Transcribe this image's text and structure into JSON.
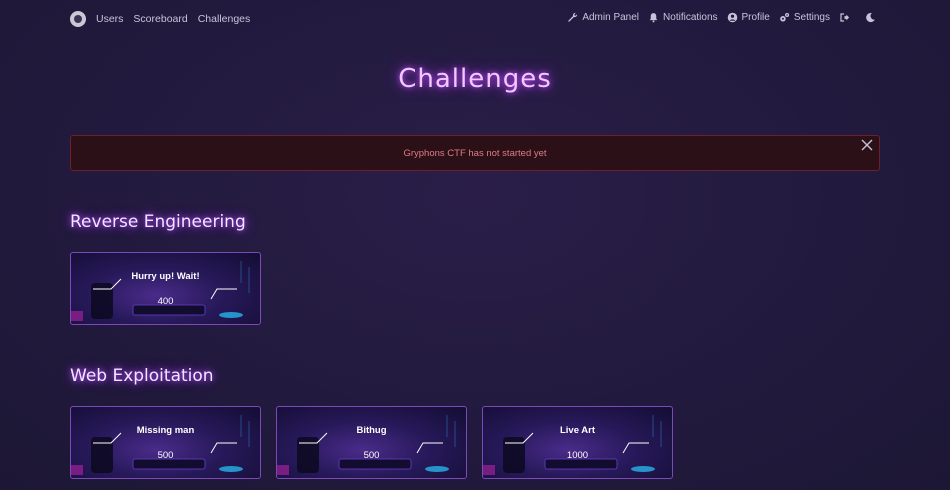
{
  "nav": {
    "links": [
      "Users",
      "Scoreboard",
      "Challenges"
    ],
    "right": [
      {
        "label": "Admin Panel",
        "icon": "wrench-icon"
      },
      {
        "label": "Notifications",
        "icon": "bell-icon"
      },
      {
        "label": "Profile",
        "icon": "user-circle-icon"
      },
      {
        "label": "Settings",
        "icon": "cogs-icon"
      }
    ],
    "logout_icon": "logout-icon",
    "theme_icon": "moon-icon"
  },
  "page": {
    "title": "Challenges"
  },
  "alert": {
    "text": "Gryphons CTF has not started yet",
    "color": "#e07a88"
  },
  "categories": [
    {
      "name": "Reverse Engineering",
      "challenges": [
        {
          "name": "Hurry up! Wait!",
          "value": "400"
        }
      ]
    },
    {
      "name": "Web Exploitation",
      "challenges": [
        {
          "name": "Missing man",
          "value": "500"
        },
        {
          "name": "Bithug",
          "value": "500"
        },
        {
          "name": "Live Art",
          "value": "1000"
        }
      ]
    }
  ],
  "colors": {
    "accent": "#c84dff",
    "background": "#221a3e",
    "card_border": "#7b4ab8"
  }
}
